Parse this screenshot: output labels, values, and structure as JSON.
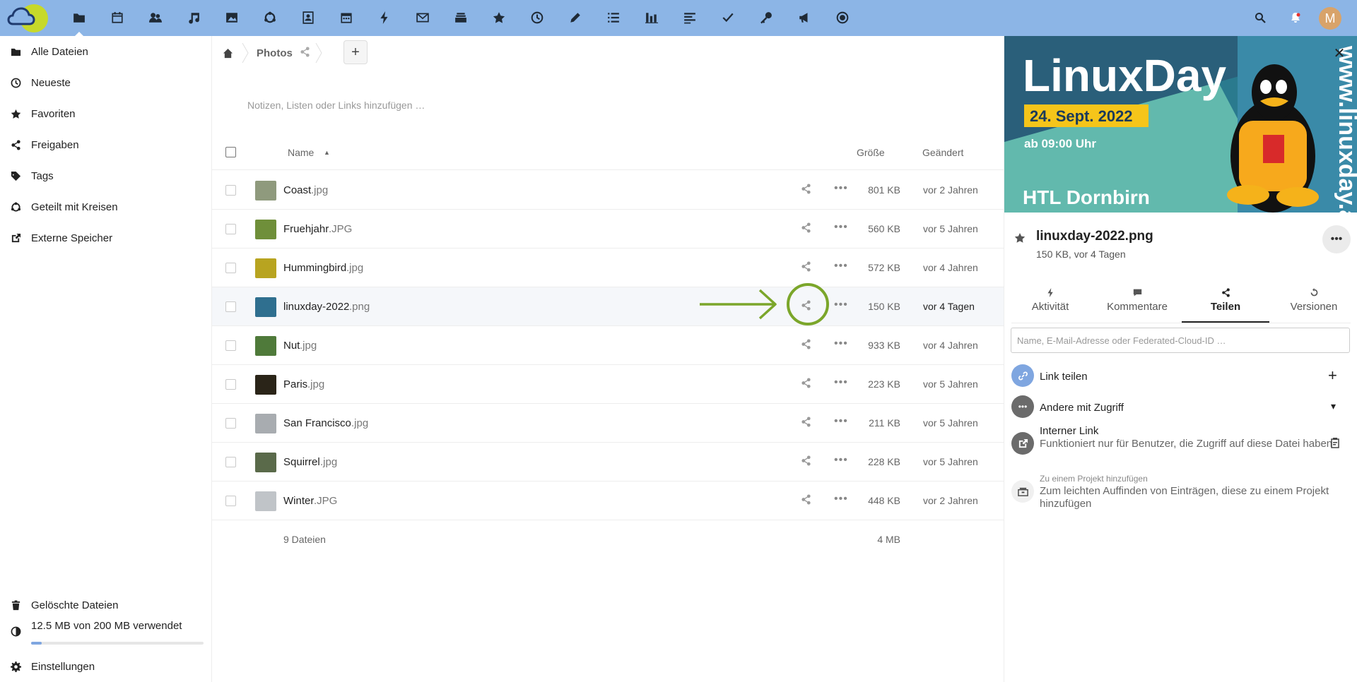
{
  "header": {
    "apps": [
      "files",
      "calendar",
      "contacts",
      "music",
      "photos",
      "circles",
      "contacts-card",
      "calendar-alt",
      "activity",
      "mail",
      "deck",
      "favorites",
      "clock",
      "notes",
      "tasks",
      "analytics",
      "text",
      "checkmark",
      "keys",
      "announcements",
      "radio"
    ]
  },
  "nav": {
    "items": [
      {
        "label": "Alle Dateien"
      },
      {
        "label": "Neueste"
      },
      {
        "label": "Favoriten"
      },
      {
        "label": "Freigaben"
      },
      {
        "label": "Tags"
      },
      {
        "label": "Geteilt mit Kreisen"
      },
      {
        "label": "Externe Speicher"
      }
    ],
    "trash": "Gelöschte Dateien",
    "quota": "12.5 MB von 200 MB verwendet",
    "quota_fraction": 0.0625,
    "settings": "Einstellungen"
  },
  "breadcrumb": {
    "folder": "Photos"
  },
  "notes_placeholder": "Notizen, Listen oder Links hinzufügen …",
  "table": {
    "headers": {
      "name": "Name",
      "sort": "▲",
      "size": "Größe",
      "modified": "Geändert"
    },
    "rows": [
      {
        "name": "Coast",
        "ext": ".jpg",
        "size": "801 KB",
        "modified": "vor 2 Jahren",
        "thumb": "#8f9a7d"
      },
      {
        "name": "Fruehjahr",
        "ext": ".JPG",
        "size": "560 KB",
        "modified": "vor 5 Jahren",
        "thumb": "#6f8f3a"
      },
      {
        "name": "Hummingbird",
        "ext": ".jpg",
        "size": "572 KB",
        "modified": "vor 4 Jahren",
        "thumb": "#b8a420"
      },
      {
        "name": "linuxday-2022",
        "ext": ".png",
        "size": "150 KB",
        "modified": "vor 4 Tagen",
        "thumb": "#2f6f8f",
        "selected": true
      },
      {
        "name": "Nut",
        "ext": ".jpg",
        "size": "933 KB",
        "modified": "vor 4 Jahren",
        "thumb": "#4f7a3a"
      },
      {
        "name": "Paris",
        "ext": ".jpg",
        "size": "223 KB",
        "modified": "vor 5 Jahren",
        "thumb": "#2a2418"
      },
      {
        "name": "San Francisco",
        "ext": ".jpg",
        "size": "211 KB",
        "modified": "vor 5 Jahren",
        "thumb": "#a8acb0"
      },
      {
        "name": "Squirrel",
        "ext": ".jpg",
        "size": "228 KB",
        "modified": "vor 5 Jahren",
        "thumb": "#5a6a4a"
      },
      {
        "name": "Winter",
        "ext": ".JPG",
        "size": "448 KB",
        "modified": "vor 2 Jahren",
        "thumb": "#c0c4c8"
      }
    ],
    "footer": {
      "count": "9 Dateien",
      "size": "4 MB"
    }
  },
  "sidebar": {
    "preview": {
      "title": "LinuxDay",
      "date": "24. Sept. 2022",
      "time": "ab 09:00 Uhr",
      "venue": "HTL Dornbirn",
      "url": "www.linuxday.at"
    },
    "close": "✕",
    "filename": "linuxday-2022.png",
    "meta": "150 KB, vor 4 Tagen",
    "more": "•••",
    "tabs": [
      {
        "label": "Aktivität"
      },
      {
        "label": "Kommentare"
      },
      {
        "label": "Teilen"
      },
      {
        "label": "Versionen"
      }
    ],
    "share_placeholder": "Name, E-Mail-Adresse oder Federated-Cloud-ID …",
    "link_share": "Link teilen",
    "link_plus": "+",
    "others": "Andere mit Zugriff",
    "others_caret": "▾",
    "internal_title": "Interner Link",
    "internal_desc": "Funktioniert nur für Benutzer, die Zugriff auf diese Datei haben",
    "project_small": "Zu einem Projekt hinzufügen",
    "project_desc": "Zum leichten Auffinden von Einträgen, diese zu einem Projekt hinzufügen"
  },
  "colors": {
    "header": "#8cb5e6",
    "annotation": "#7ba62a",
    "link_avatar": "#7fa6e0"
  }
}
